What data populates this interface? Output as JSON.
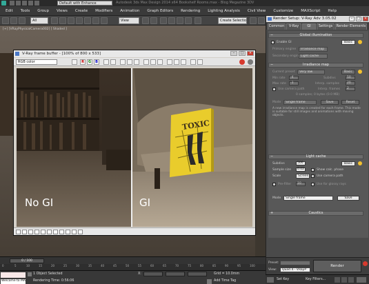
{
  "app": {
    "title_dropdown": "Default with Enhance",
    "title_text": "Autodesk 3ds Max Design 2014 x64   Bookshelf Rooms.max - Blog Megazine 3DV"
  },
  "menu": [
    "Edit",
    "Tools",
    "Group",
    "Views",
    "Create",
    "Modifiers",
    "Animation",
    "Graph Editors",
    "Rendering",
    "Lighting Analysis",
    "Civil View",
    "Customize",
    "MAXScript",
    "Help"
  ],
  "toolbar": {
    "filter": "All",
    "view": "View",
    "selection_set": "Create Selection Se"
  },
  "viewport": {
    "label": "[+] [VRayPhysicalCamera002] [ Shaded ]"
  },
  "frame_buffer": {
    "title": "V-Ray frame buffer - [100% of 800 x 533]",
    "channel": "RGB color",
    "buttons": [
      "R",
      "G",
      "B"
    ],
    "left_label": "No GI",
    "right_label": "GI",
    "book_title": "TOXIC"
  },
  "render_setup": {
    "title": "Render Setup: V-Ray Adv 3.05.02",
    "tabs": [
      "Common",
      "V-Ray",
      "GI",
      "Settings",
      "Render Elements"
    ],
    "active_tab": "GI",
    "gi_section": {
      "header": "Global illumination",
      "enable_gi": "Enable GI",
      "mode_basic": "Basic",
      "primary_label": "Primary engine",
      "primary_value": "Irradiance map",
      "secondary_label": "Secondary engine",
      "secondary_value": "Light cache"
    },
    "irradiance_section": {
      "header": "Irradiance map",
      "preset_label": "Current preset",
      "preset_value": "Very low",
      "mode_basic": "Basic",
      "min_rate_label": "Min rate",
      "min_rate": "-4",
      "max_rate_label": "Max rate",
      "max_rate": "-3",
      "subdivs_label": "Subdivs",
      "subdivs": "50",
      "interp_label": "Interp. samples",
      "interp": "20",
      "interp_frames_label": "Interp. frames",
      "interp_frames": "2",
      "show_calc": "Use camera path",
      "info": "0 samples; 0 bytes (0.0 MB)",
      "mode_label": "Mode",
      "mode_value": "Single frame",
      "save_btn": "Save",
      "reset_btn": "Reset",
      "description": "A new irradiance map is created for each frame. This mode is suitable for still images and animations with moving objects."
    },
    "light_cache_section": {
      "header": "Light cache",
      "subdivs_label": "Subdivs",
      "subdivs": "500",
      "mode_basic": "Basic",
      "sample_size_label": "Sample size",
      "sample_size": "0.02",
      "scale_label": "Scale",
      "scale_value": "Screen",
      "show_calc": "Show calc. phase",
      "use_camera": "Use camera path",
      "prefilter": "Pre-filter",
      "prefilter_val": "10",
      "glossy": "Use for glossy rays",
      "mode_label": "Mode",
      "mode_value": "Single frame",
      "save_btn": "Save"
    },
    "caustics_header": "Caustics",
    "bottom": {
      "preset_label": "Preset:",
      "view_label": "View:",
      "view_value": "Quad 4 - VRayP",
      "render_btn": "Render"
    }
  },
  "timeline": {
    "slider": "0 / 100",
    "ticks": [
      "0",
      "5",
      "10",
      "15",
      "20",
      "25",
      "30",
      "35",
      "40",
      "45",
      "50",
      "55",
      "60",
      "65",
      "70",
      "75",
      "80",
      "85",
      "90",
      "95",
      "100"
    ]
  },
  "status": {
    "cmd": "Welcome to MAXScri",
    "selection": "1 Object Selected",
    "rendering_time": "Rendering Time: 0:56:06",
    "x_label": "X:",
    "grid": "Grid = 10.0mm",
    "add_time_tag": "Add Time Tag",
    "set_key": "Set Key",
    "key_filters": "Key Filters..."
  }
}
